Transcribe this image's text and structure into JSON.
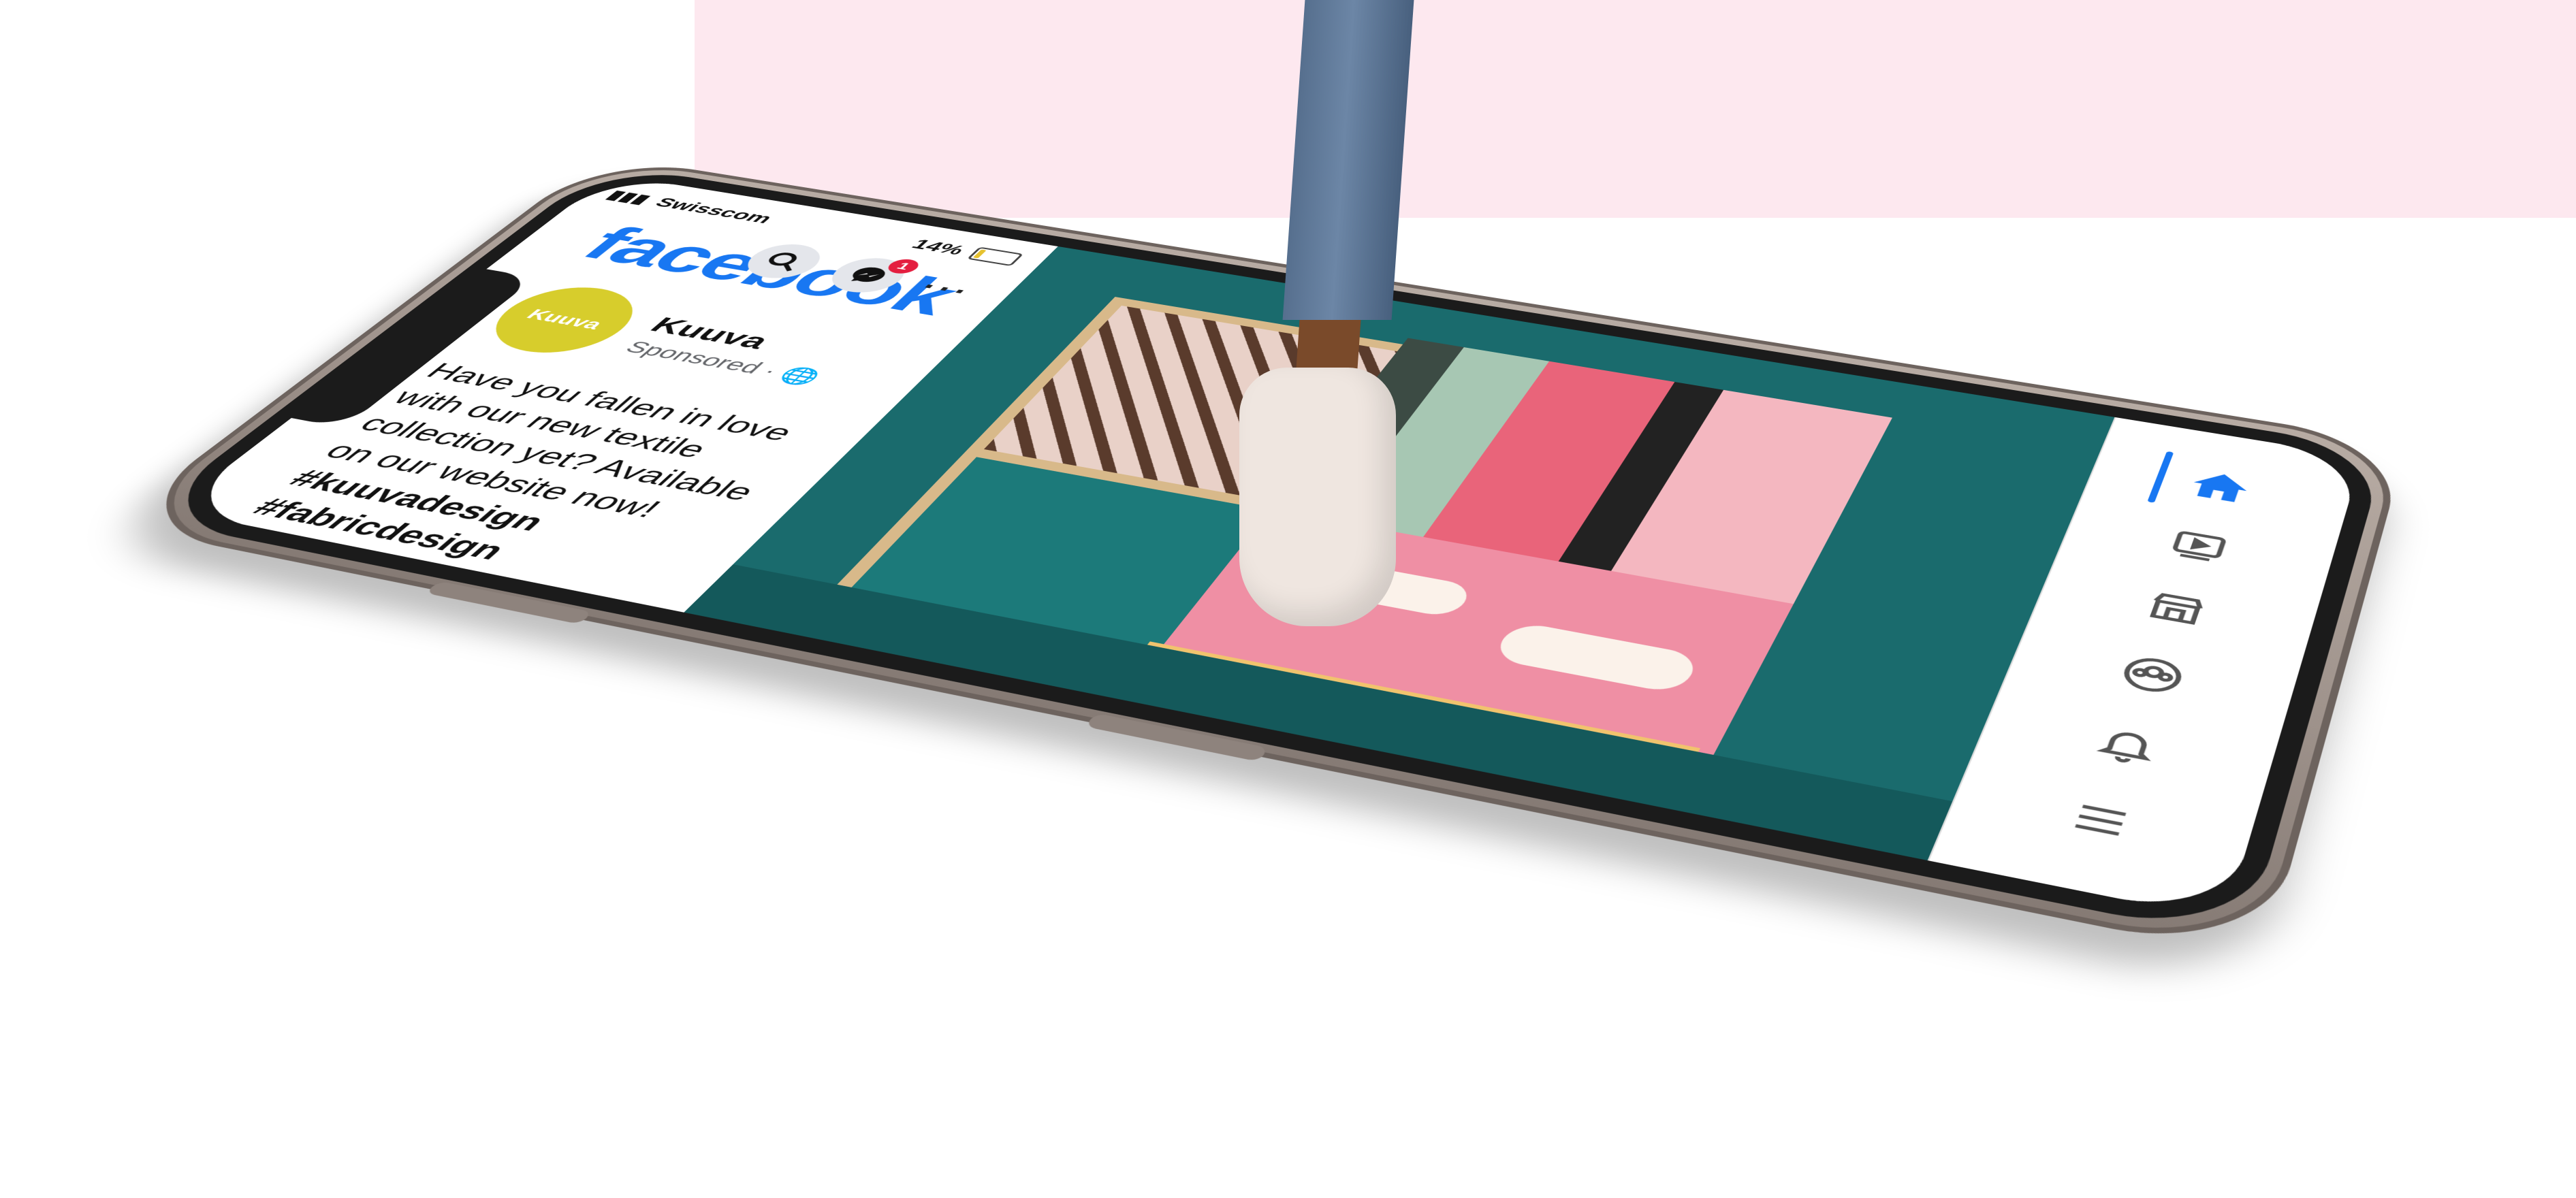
{
  "status_bar": {
    "carrier": "Swisscom",
    "battery": "14%",
    "battery_level": 0.14
  },
  "header": {
    "app_title": "facebook",
    "search_icon": "search-icon",
    "messenger_icon": "messenger-icon",
    "messenger_badge": "1",
    "more_icon": "more-icon"
  },
  "post": {
    "avatar_text": "Kuuva",
    "author": "Kuuva",
    "sponsored": "Sponsored ·",
    "text": "Have you fallen in love with our new textile collection yet? Available on our website now!",
    "hashtags": "#kuuvadesign #fabricdesign #homedecor"
  },
  "tabbar": {
    "items": [
      {
        "icon": "home-icon",
        "active": true
      },
      {
        "icon": "video-icon",
        "active": false
      },
      {
        "icon": "marketplace-icon",
        "active": false
      },
      {
        "icon": "groups-icon",
        "active": false
      },
      {
        "icon": "bell-icon",
        "active": false
      },
      {
        "icon": "menu-icon",
        "active": false
      }
    ]
  },
  "colors": {
    "facebook_blue": "#1877f2",
    "badge_red": "#e41e3f",
    "avatar_yellow": "#d7cd2c",
    "photo_teal": "#1a6b6d"
  }
}
